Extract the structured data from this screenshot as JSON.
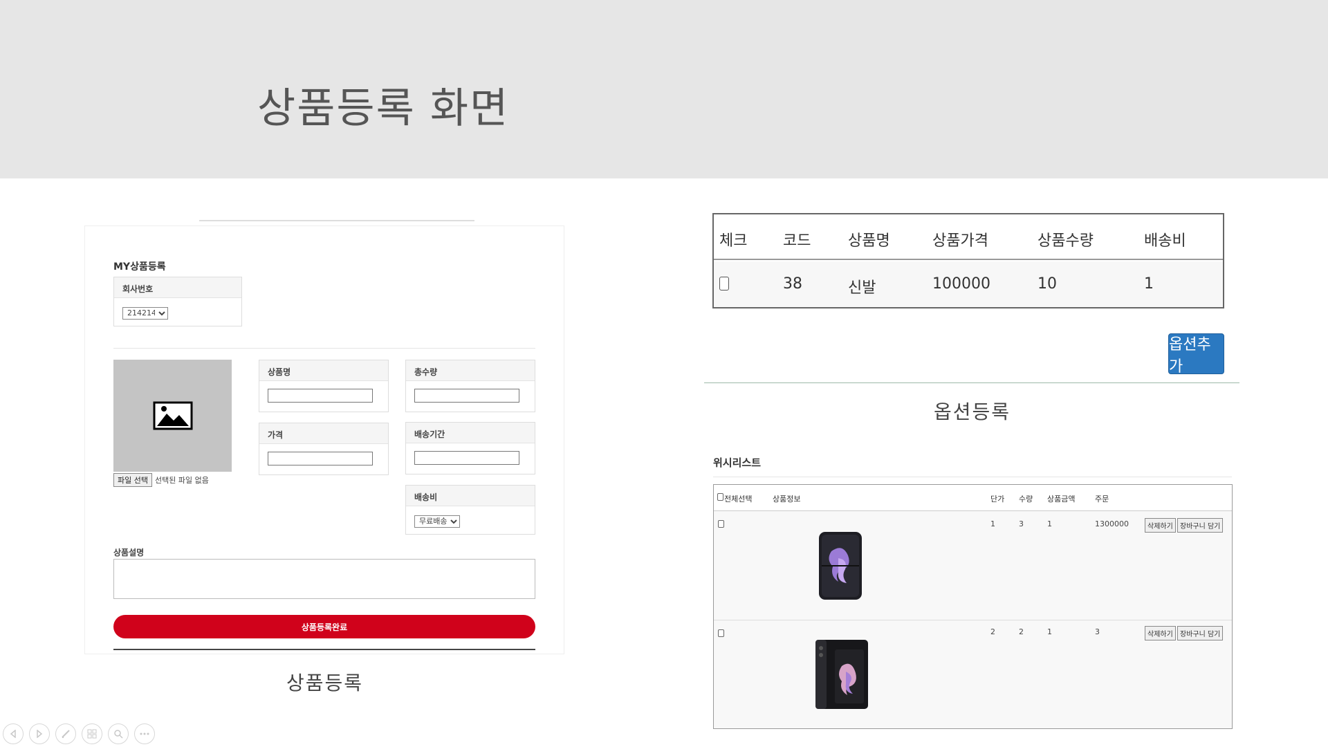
{
  "banner": {
    "title": "상품등록 화면"
  },
  "product_form": {
    "section_title": "MY상품등록",
    "company": {
      "label": "회사번호",
      "selected": "214214"
    },
    "fields": {
      "name_label": "상품명",
      "quantity_label": "총수량",
      "price_label": "가격",
      "period_label": "배송기간",
      "shipping_fee_label": "배송비",
      "shipping_fee_selected": "무료배송"
    },
    "file": {
      "button_label": "파일 선택",
      "status": "선택된 파일 없음"
    },
    "description_label": "상품설명",
    "submit_label": "상품등록완료",
    "caption": "상품등록"
  },
  "option_table": {
    "headers": [
      "체크",
      "코드",
      "상품명",
      "상품가격",
      "상품수량",
      "배송비"
    ],
    "row": {
      "code": "38",
      "name": "신발",
      "price": "100000",
      "quantity": "10",
      "shipping": "1"
    },
    "add_button": "옵션추가",
    "caption": "옵션등록"
  },
  "wishlist": {
    "title": "위시리스트",
    "headers": {
      "select_all": "전체선택",
      "info": "상품정보",
      "unit": "단가",
      "qty": "수량",
      "amount": "상품금액",
      "order": "주문"
    },
    "rows": [
      {
        "unit": "1",
        "qty": "3",
        "amount": "1",
        "order": "1300000",
        "delete": "삭제하기",
        "cart": "장바구니 담기"
      },
      {
        "unit": "2",
        "qty": "2",
        "amount": "1",
        "order": "3",
        "delete": "삭제하기",
        "cart": "장바구니 담기"
      }
    ]
  },
  "controls": [
    "prev-icon",
    "next-icon",
    "pen-icon",
    "slides-icon",
    "zoom-icon",
    "more-icon"
  ]
}
